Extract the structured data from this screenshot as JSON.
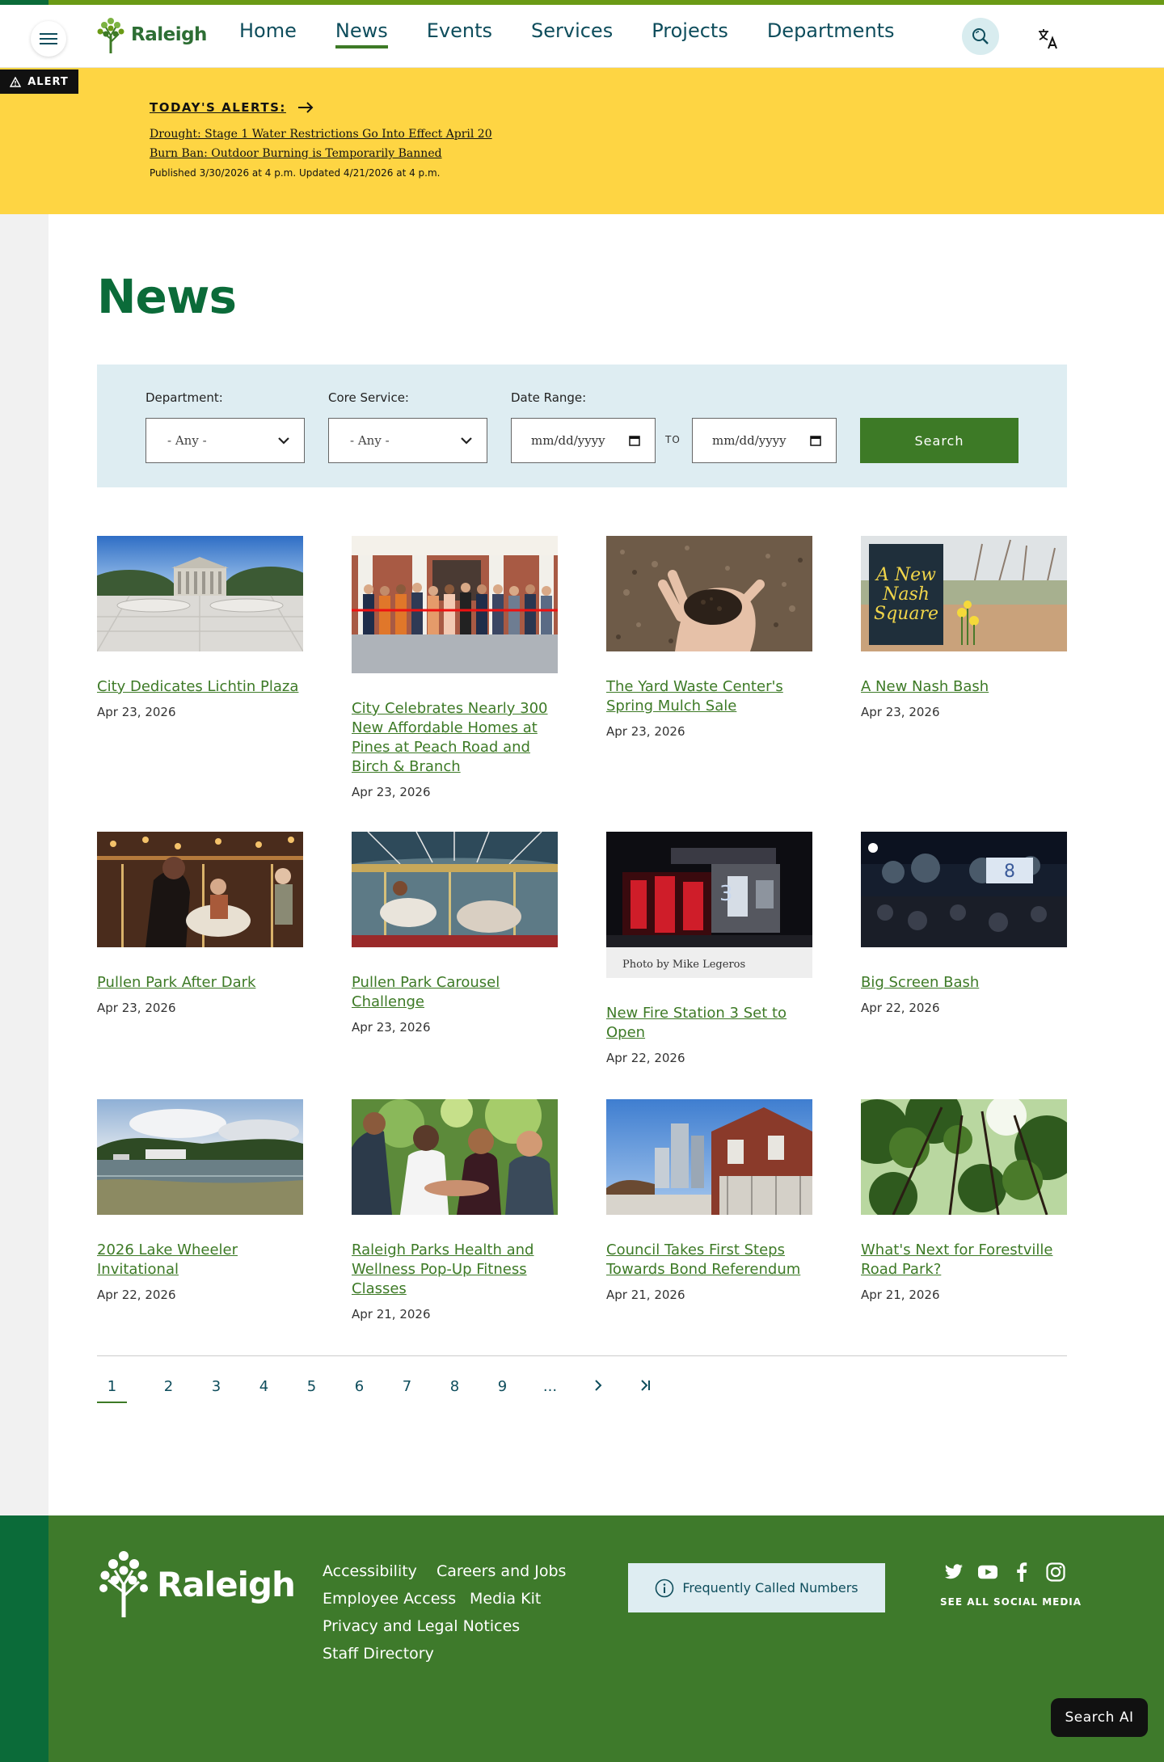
{
  "header": {
    "logo_text": "Raleigh",
    "nav": [
      {
        "label": "Home",
        "active": false
      },
      {
        "label": "News",
        "active": true
      },
      {
        "label": "Events",
        "active": false
      },
      {
        "label": "Services",
        "active": false
      },
      {
        "label": "Projects",
        "active": false
      },
      {
        "label": "Departments",
        "active": false
      }
    ],
    "menu_icon": "hamburger-menu-icon",
    "search_icon": "search-icon",
    "translate_icon": "translate-icon",
    "accent_color": "#3d7a26"
  },
  "alert": {
    "tag": "ALERT",
    "heading": "TODAY'S ALERTS:",
    "links": [
      "Drought: Stage 1 Water Restrictions Go Into Effect April 20",
      "Burn Ban: Outdoor Burning is Temporarily Banned"
    ],
    "meta": "Published 3/30/2026 at 4 p.m.   Updated 4/21/2026 at 4 p.m.",
    "background": "#fed543"
  },
  "page": {
    "title": "News"
  },
  "filters": {
    "department_label": "Department:",
    "department_value": "- Any -",
    "core_service_label": "Core Service:",
    "core_service_value": "- Any -",
    "date_range_label": "Date Range:",
    "date_from": "mm/dd/yyyy",
    "date_to": "mm/dd/yyyy",
    "to_label": "TO",
    "search_label": "Search"
  },
  "news": [
    {
      "title": "City Dedicates Lichtin Plaza",
      "date": "Apr 23, 2026"
    },
    {
      "title": "City Celebrates Nearly 300 New Affordable Homes at Pines at Peach Road and Birch & Branch",
      "date": "Apr 23, 2026"
    },
    {
      "title": "The Yard Waste Center's Spring Mulch Sale",
      "date": "Apr 23, 2026"
    },
    {
      "title": "A New Nash Bash",
      "date": "Apr 23, 2026",
      "image_text": "A New Nash Square"
    },
    {
      "title": "Pullen Park After Dark",
      "date": "Apr 23, 2026"
    },
    {
      "title": "Pullen Park Carousel Challenge",
      "date": "Apr 23, 2026"
    },
    {
      "title": "New Fire Station 3 Set to Open",
      "date": "Apr 22, 2026",
      "caption": "Photo by Mike Legeros"
    },
    {
      "title": "Big Screen Bash",
      "date": "Apr 22, 2026"
    },
    {
      "title": "2026 Lake Wheeler Invitational",
      "date": "Apr 22, 2026"
    },
    {
      "title": "Raleigh Parks Health and Wellness Pop-Up Fitness Classes",
      "date": "Apr 21, 2026"
    },
    {
      "title": "Council Takes First Steps Towards Bond Referendum",
      "date": "Apr 21, 2026"
    },
    {
      "title": "What's Next for Forestville Road Park?",
      "date": "Apr 21, 2026"
    }
  ],
  "pagination": {
    "pages": [
      "1",
      "2",
      "3",
      "4",
      "5",
      "6",
      "7",
      "8",
      "9",
      "..."
    ],
    "current": "1",
    "next": "›",
    "last": "›|"
  },
  "footer": {
    "logo_text": "Raleigh",
    "links": [
      "Accessibility",
      "Careers and Jobs",
      "Employee Access",
      "Media Kit",
      "Privacy and Legal Notices",
      "Staff Directory"
    ],
    "fcn_label": "Frequently Called Numbers",
    "social": [
      "twitter-icon",
      "youtube-icon",
      "facebook-icon",
      "instagram-icon"
    ],
    "see_all_social": "SEE ALL SOCIAL MEDIA",
    "background": "#3e7a2b"
  },
  "search_ai": {
    "label": "Search AI"
  }
}
